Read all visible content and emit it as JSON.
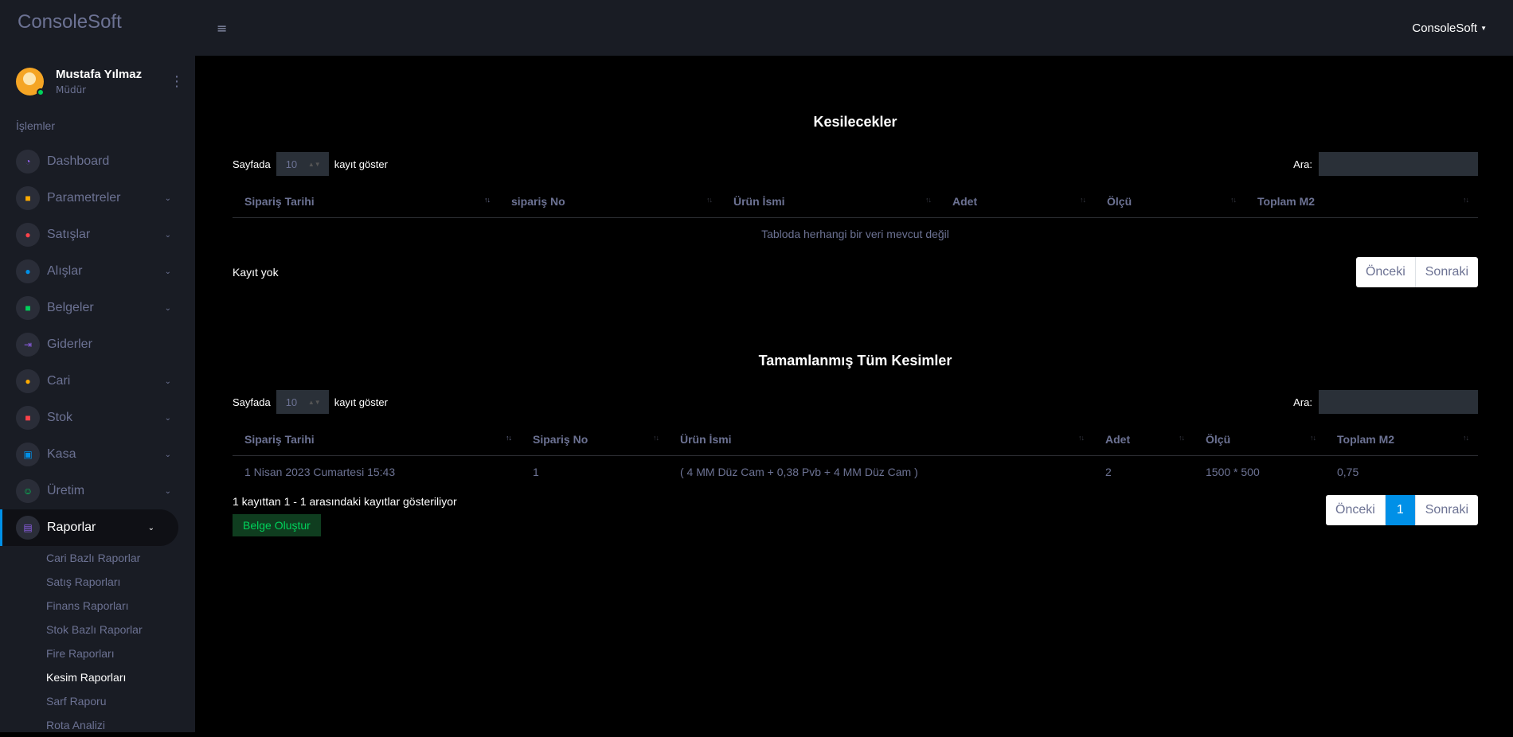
{
  "brand": "ConsoleSoft",
  "topbar": {
    "user_label": "ConsoleSoft"
  },
  "profile": {
    "name": "Mustafa Yılmaz",
    "role": "Müdür"
  },
  "section_label": "İşlemler",
  "nav": [
    {
      "label": "Dashboard",
      "icon": "speedometer-icon",
      "color": "#8f5fe8",
      "has_children": false
    },
    {
      "label": "Parametreler",
      "icon": "layers-icon",
      "color": "#ffab00",
      "has_children": true
    },
    {
      "label": "Satışlar",
      "icon": "play-icon",
      "color": "#fc424a",
      "has_children": true
    },
    {
      "label": "Alışlar",
      "icon": "minus-circle-icon",
      "color": "#0090e7",
      "has_children": true
    },
    {
      "label": "Belgeler",
      "icon": "book-icon",
      "color": "#00d25b",
      "has_children": true
    },
    {
      "label": "Giderler",
      "icon": "arrow-collapse-icon",
      "color": "#8f5fe8",
      "has_children": false
    },
    {
      "label": "Cari",
      "icon": "people-icon",
      "color": "#ffab00",
      "has_children": true
    },
    {
      "label": "Stok",
      "icon": "box-icon",
      "color": "#fc424a",
      "has_children": true
    },
    {
      "label": "Kasa",
      "icon": "cash-icon",
      "color": "#0090e7",
      "has_children": true
    },
    {
      "label": "Üretim",
      "icon": "factory-icon",
      "color": "#00d25b",
      "has_children": true
    },
    {
      "label": "Raporlar",
      "icon": "clipboard-icon",
      "color": "#8f5fe8",
      "has_children": true
    }
  ],
  "sub_nav": [
    "Cari Bazlı Raporlar",
    "Satış Raporları",
    "Finans Raporları",
    "Stok Bazlı Raporlar",
    "Fire Raporları",
    "Kesim Raporları",
    "Sarf Raporu",
    "Rota Analizi"
  ],
  "current_sub": "Kesim Raporları",
  "table1": {
    "title": "Kesilecekler",
    "length_prefix": "Sayfada",
    "length_value": "10",
    "length_suffix": "kayıt göster",
    "search_label": "Ara:",
    "columns": [
      "Sipariş Tarihi",
      "sipariş No",
      "Ürün İsmi",
      "Adet",
      "Ölçü",
      "Toplam M2"
    ],
    "empty_text": "Tabloda herhangi bir veri mevcut değil",
    "info": "Kayıt yok",
    "prev": "Önceki",
    "next": "Sonraki"
  },
  "table2": {
    "title": "Tamamlanmış Tüm Kesimler",
    "length_prefix": "Sayfada",
    "length_value": "10",
    "length_suffix": "kayıt göster",
    "search_label": "Ara:",
    "columns": [
      "Sipariş Tarihi",
      "Sipariş No",
      "Ürün İsmi",
      "Adet",
      "Ölçü",
      "Toplam M2"
    ],
    "rows": [
      [
        "1 Nisan 2023 Cumartesi 15:43",
        "1",
        "( 4 MM Düz Cam + 0,38 Pvb + 4 MM Düz Cam )",
        "2",
        "1500 * 500",
        "0,75"
      ]
    ],
    "info": "1 kayıttan 1 - 1 arasındaki kayıtlar gösteriliyor",
    "prev": "Önceki",
    "page": "1",
    "next": "Sonraki",
    "action": "Belge Oluştur"
  }
}
